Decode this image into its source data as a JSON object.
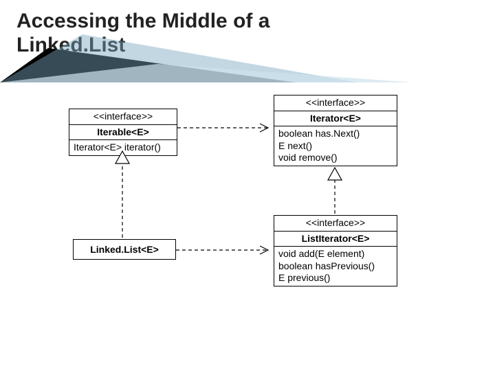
{
  "title_line1": "Accessing the Middle of a",
  "title_line2": "Linked.List",
  "iterable": {
    "stereotype": "<<interface>>",
    "name": "Iterable<E>",
    "op1": "Iterator<E> iterator()"
  },
  "iterator": {
    "stereotype": "<<interface>>",
    "name": "Iterator<E>",
    "op1": "boolean has.Next()",
    "op2": "E next()",
    "op3": "void remove()"
  },
  "linkedlist": {
    "name": "Linked.List<E>"
  },
  "listiterator": {
    "stereotype": "<<interface>>",
    "name": "ListIterator<E>",
    "op1": "void add(E element)",
    "op2": "boolean hasPrevious()",
    "op3": "E previous()"
  }
}
